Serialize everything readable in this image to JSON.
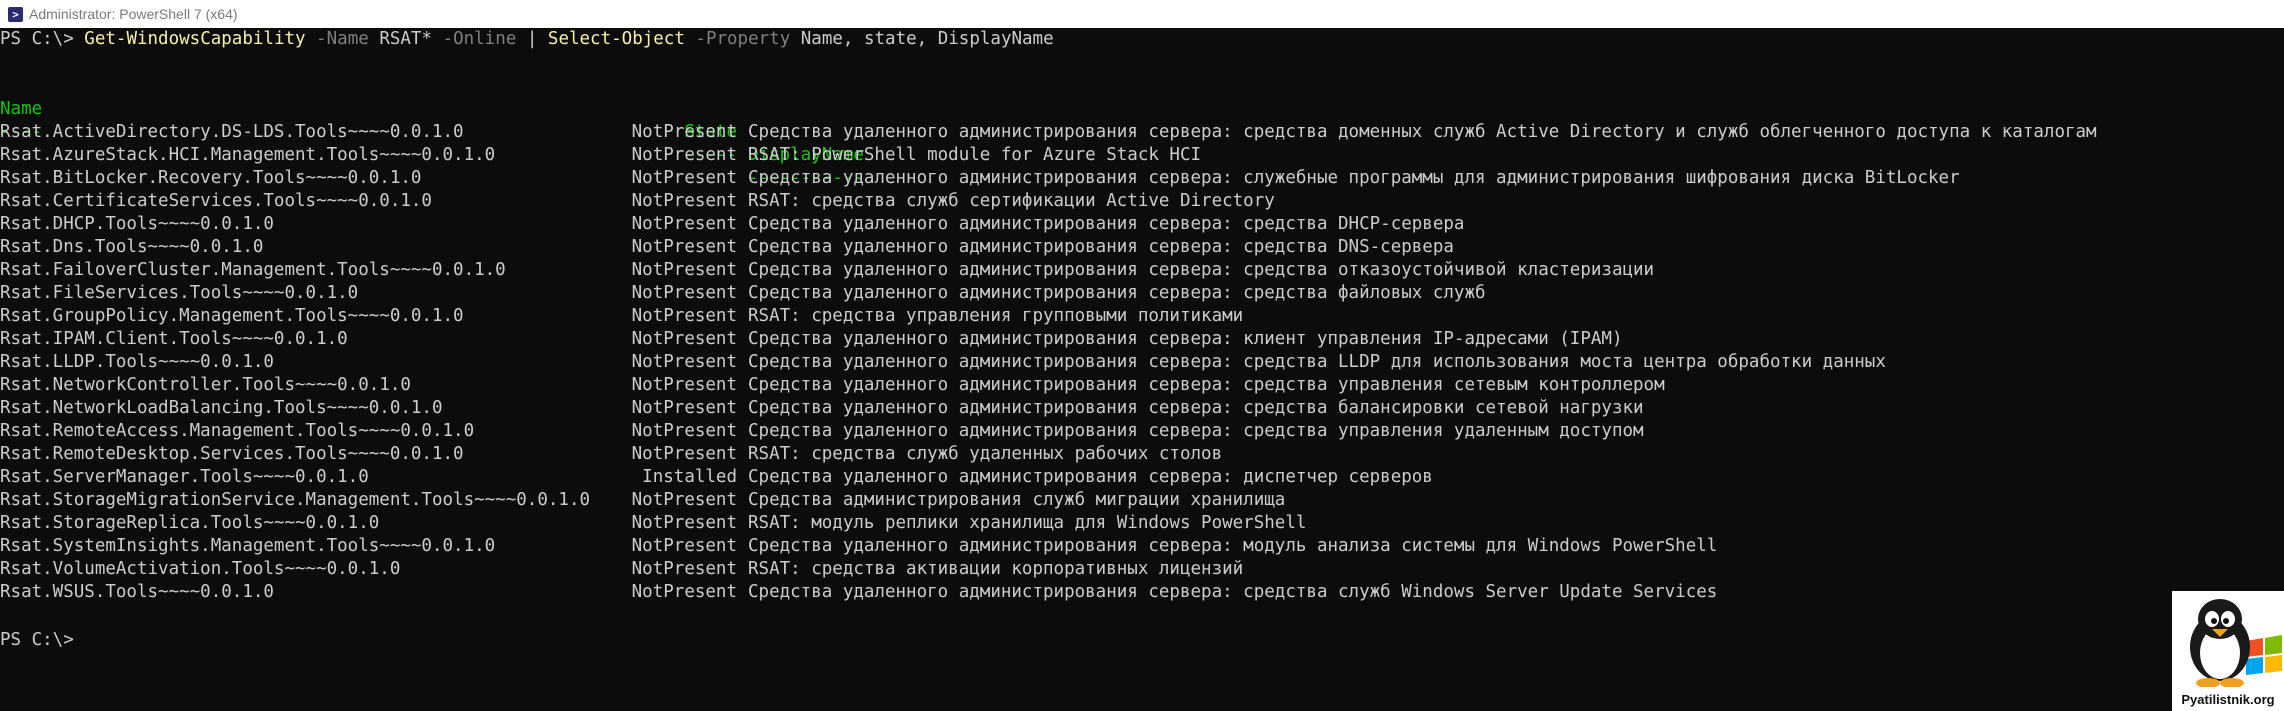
{
  "window": {
    "title": "Administrator: PowerShell 7 (x64)",
    "icon": "powershell-icon"
  },
  "command": {
    "prompt": "PS C:\\> ",
    "cmdlet": "Get-WindowsCapability",
    "param1": " -Name",
    "value1": " RSAT*",
    "param2": " -Online",
    "pipe": " | ",
    "cmdlet2": "Select-Object",
    "param3": " -Property",
    "value3": " Name, state, DisplayName"
  },
  "table": {
    "headers": {
      "name": "Name",
      "state": "State",
      "display": "DisplayName"
    },
    "separators": {
      "name": "----",
      "state": "-----",
      "display": "-----------"
    },
    "rows": [
      {
        "name": "Rsat.ActiveDirectory.DS-LDS.Tools~~~~0.0.1.0",
        "state": "NotPresent",
        "display": "Средства удаленного администрирования сервера: средства доменных служб Active Directory и служб облегченного доступа к каталогам"
      },
      {
        "name": "Rsat.AzureStack.HCI.Management.Tools~~~~0.0.1.0",
        "state": "NotPresent",
        "display": "RSAT: PowerShell module for Azure Stack HCI"
      },
      {
        "name": "Rsat.BitLocker.Recovery.Tools~~~~0.0.1.0",
        "state": "NotPresent",
        "display": "Средства удаленного администрирования сервера: служебные программы для администрирования шифрования диска BitLocker"
      },
      {
        "name": "Rsat.CertificateServices.Tools~~~~0.0.1.0",
        "state": "NotPresent",
        "display": "RSAT: средства служб сертификации Active Directory"
      },
      {
        "name": "Rsat.DHCP.Tools~~~~0.0.1.0",
        "state": "NotPresent",
        "display": "Средства удаленного администрирования сервера: средства DHCP-сервера"
      },
      {
        "name": "Rsat.Dns.Tools~~~~0.0.1.0",
        "state": "NotPresent",
        "display": "Средства удаленного администрирования сервера: средства DNS-сервера"
      },
      {
        "name": "Rsat.FailoverCluster.Management.Tools~~~~0.0.1.0",
        "state": "NotPresent",
        "display": "Средства удаленного администрирования сервера: средства отказоустойчивой кластеризации"
      },
      {
        "name": "Rsat.FileServices.Tools~~~~0.0.1.0",
        "state": "NotPresent",
        "display": "Средства удаленного администрирования сервера: средства файловых служб"
      },
      {
        "name": "Rsat.GroupPolicy.Management.Tools~~~~0.0.1.0",
        "state": "NotPresent",
        "display": "RSAT: средства управления групповыми политиками"
      },
      {
        "name": "Rsat.IPAM.Client.Tools~~~~0.0.1.0",
        "state": "NotPresent",
        "display": "Средства удаленного администрирования сервера: клиент управления IP-адресами (IPAM)"
      },
      {
        "name": "Rsat.LLDP.Tools~~~~0.0.1.0",
        "state": "NotPresent",
        "display": "Средства удаленного администрирования сервера: средства LLDP для использования моста центра обработки данных"
      },
      {
        "name": "Rsat.NetworkController.Tools~~~~0.0.1.0",
        "state": "NotPresent",
        "display": "Средства удаленного администрирования сервера: средства управления сетевым контроллером"
      },
      {
        "name": "Rsat.NetworkLoadBalancing.Tools~~~~0.0.1.0",
        "state": "NotPresent",
        "display": "Средства удаленного администрирования сервера: средства балансировки сетевой нагрузки"
      },
      {
        "name": "Rsat.RemoteAccess.Management.Tools~~~~0.0.1.0",
        "state": "NotPresent",
        "display": "Средства удаленного администрирования сервера: средства управления удаленным доступом"
      },
      {
        "name": "Rsat.RemoteDesktop.Services.Tools~~~~0.0.1.0",
        "state": "NotPresent",
        "display": "RSAT: средства служб удаленных рабочих столов"
      },
      {
        "name": "Rsat.ServerManager.Tools~~~~0.0.1.0",
        "state": "Installed",
        "display": "Средства удаленного администрирования сервера: диспетчер серверов"
      },
      {
        "name": "Rsat.StorageMigrationService.Management.Tools~~~~0.0.1.0",
        "state": "NotPresent",
        "display": "Средства администрирования служб миграции хранилища"
      },
      {
        "name": "Rsat.StorageReplica.Tools~~~~0.0.1.0",
        "state": "NotPresent",
        "display": "RSAT: модуль реплики хранилища для Windows PowerShell"
      },
      {
        "name": "Rsat.SystemInsights.Management.Tools~~~~0.0.1.0",
        "state": "NotPresent",
        "display": "Средства удаленного администрирования сервера: модуль анализа системы для Windows PowerShell"
      },
      {
        "name": "Rsat.VolumeActivation.Tools~~~~0.0.1.0",
        "state": "NotPresent",
        "display": "RSAT: средства активации корпоративных лицензий"
      },
      {
        "name": "Rsat.WSUS.Tools~~~~0.0.1.0",
        "state": "NotPresent",
        "display": "Средства удаленного администрирования сервера: средства служб Windows Server Update Services"
      }
    ]
  },
  "final_prompt": "PS C:\\>",
  "watermark": {
    "text": "Pyatilistnik.org",
    "icon": "penguin-logo"
  },
  "colors": {
    "background": "#0c0c0c",
    "text": "#cccccc",
    "cmdlet": "#f9f1a5",
    "parameter": "#7f7f7f",
    "header": "#16c60c"
  }
}
